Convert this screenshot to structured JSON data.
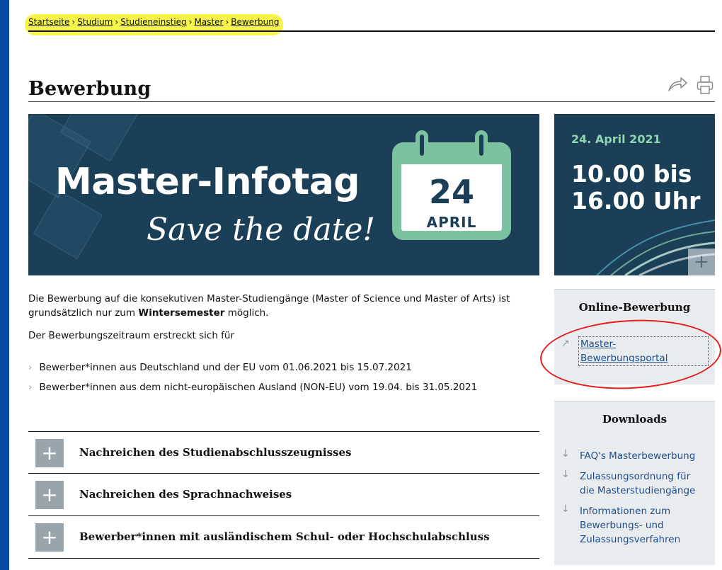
{
  "breadcrumb": [
    "Startseite",
    "Studium",
    "Studieneinstieg",
    "Master",
    "Bewerbung"
  ],
  "breadcrumb_sep": "›",
  "page_title": "Bewerbung",
  "banner": {
    "title": "Master-Infotag",
    "subtitle": "Save the date!",
    "day": "24",
    "month": "APRIL"
  },
  "side_banner": {
    "date": "24. April 2021",
    "time_line1": "10.00 bis",
    "time_line2": "16.00 Uhr",
    "plus": "+"
  },
  "intro": {
    "p1_a": "Die Bewerbung auf die konsekutiven Master-Studiengänge (Master of Science und Master of Arts) ist grundsätzlich nur zum ",
    "p1_bold": "Wintersemester",
    "p1_b": " möglich.",
    "p2": "Der Bewerbungszeitraum erstreckt sich für"
  },
  "bullets": [
    "Bewerber*innen aus Deutschland und der EU vom 01.06.2021 bis 15.07.2021",
    "Bewerber*innen aus dem nicht-europäischen Ausland (NON-EU) vom 19.04. bis 31.05.2021"
  ],
  "accordion": [
    "Nachreichen des Studienabschlusszeugnisses",
    "Nachreichen des Sprachnachweises",
    "Bewerber*innen mit ausländischem Schul- oder Hochschulabschluss"
  ],
  "accordion_plus": "+",
  "online": {
    "heading": "Online-Bewerbung",
    "link_line1": "Master-",
    "link_line2": "Bewerbungsportal"
  },
  "downloads": {
    "heading": "Downloads",
    "items": [
      {
        "line1": "FAQ's Masterbewerbung",
        "line2": "",
        "line3": ""
      },
      {
        "line1": "Zulassungsordnung für",
        "line2": "die Masterstudiengänge",
        "line3": ""
      },
      {
        "line1": "Informationen zum",
        "line2": "Bewerbungs- und",
        "line3": "Zulassungsverfahren"
      }
    ]
  },
  "colors": {
    "outer": "#0b4aa3",
    "banner": "#1a3f56",
    "mint": "#7dc2a0",
    "link": "#1d4e89",
    "highlight": "#f7f54a",
    "annotation": "#e81b1b"
  },
  "icons": {
    "share": "share-icon",
    "print": "print-icon",
    "external": "external-link-icon",
    "download": "download-arrow-icon",
    "plus": "plus-icon"
  }
}
